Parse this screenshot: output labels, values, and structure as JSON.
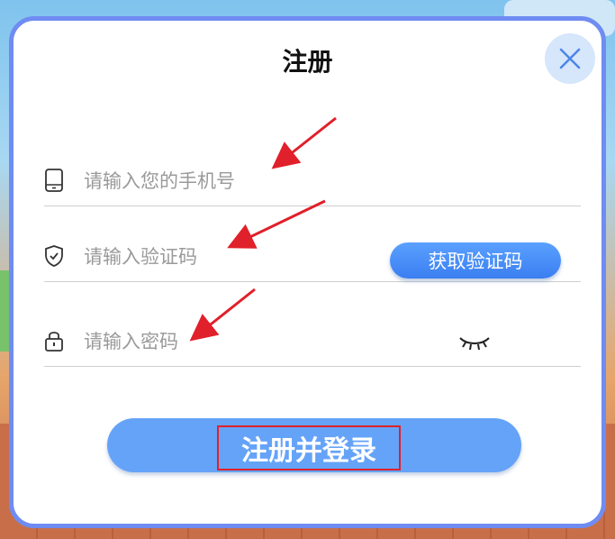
{
  "dialog": {
    "title": "注册",
    "close_icon": "close-icon"
  },
  "form": {
    "phone_placeholder": "请输入您的手机号",
    "phone_icon": "phone-icon",
    "code_placeholder": "请输入验证码",
    "code_icon": "shield-icon",
    "get_code_label": "获取验证码",
    "password_placeholder": "请输入密码",
    "password_icon": "lock-icon",
    "visibility_icon": "eye-closed-icon",
    "submit_label": "注册并登录"
  },
  "colors": {
    "accent": "#3b7ef1",
    "submit_bg": "#65a3f8",
    "border": "#6f8cf2",
    "annotation": "#e0202a"
  }
}
